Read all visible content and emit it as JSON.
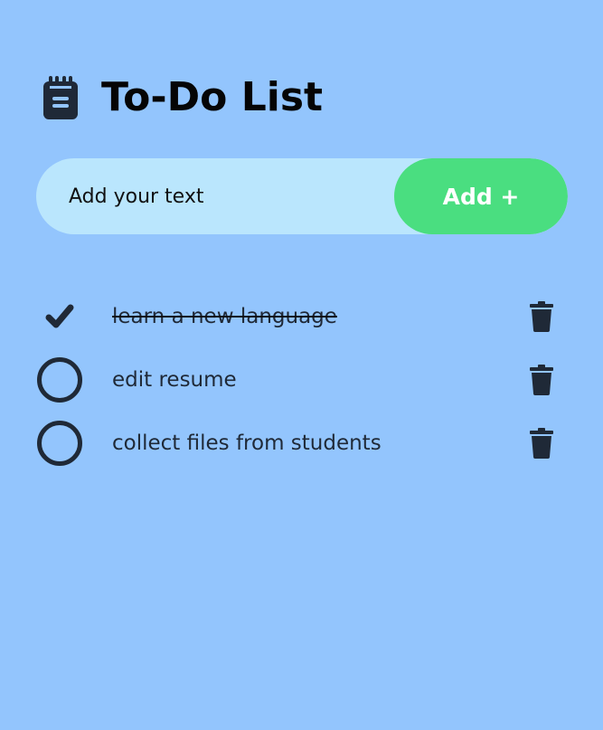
{
  "header": {
    "icon": "notepad-icon",
    "title": "To-Do List"
  },
  "input": {
    "placeholder": "Add your text",
    "value": ""
  },
  "add_button": {
    "label": "Add +"
  },
  "todos": [
    {
      "text": "learn a new language",
      "completed": true
    },
    {
      "text": "edit resume",
      "completed": false
    },
    {
      "text": "collect files from students",
      "completed": false
    }
  ],
  "icons": {
    "checked": "checkmark-icon",
    "unchecked": "empty-circle-icon",
    "delete": "trash-icon"
  },
  "colors": {
    "background": "#93c5fd",
    "input_background": "#bae6fd",
    "accent": "#4ade80",
    "icon": "#1f2937"
  }
}
